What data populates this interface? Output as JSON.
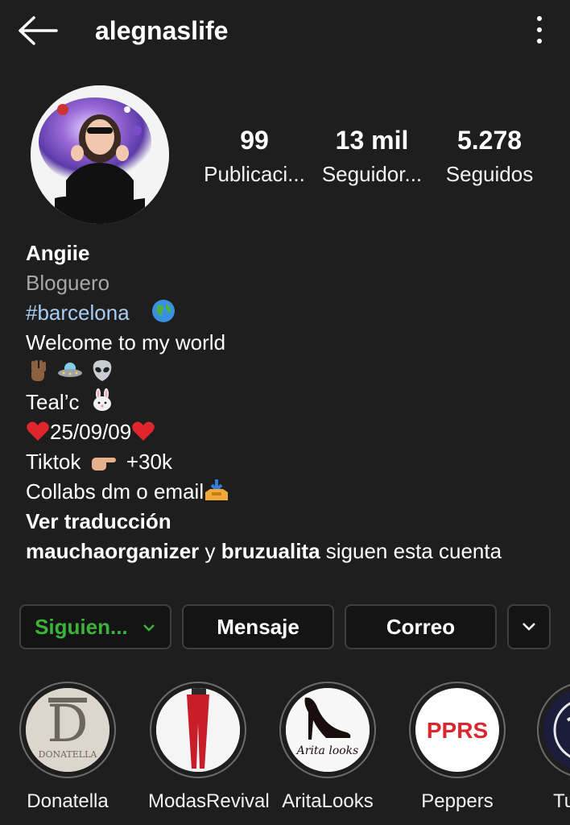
{
  "header": {
    "username": "alegnaslife"
  },
  "stats": [
    {
      "value": "99",
      "label": "Publicaci..."
    },
    {
      "value": "13 mil",
      "label": "Seguidor..."
    },
    {
      "value": "5.278",
      "label": "Seguidos"
    }
  ],
  "bio": {
    "name": "Angiie",
    "category": "Bloguero",
    "hashtag": "#barcelona",
    "line_welcome": "Welcome to my world",
    "line_tealc": "Teal’c",
    "line_date": "25/09/09",
    "line_tiktok_a": "Tiktok",
    "line_tiktok_b": "+30k",
    "line_collabs": "Collabs dm o email",
    "translate": "Ver traducción",
    "followed_by_1": "mauchaorganizer",
    "followed_by_sep": " y ",
    "followed_by_2": "bruzualita",
    "followed_by_suffix": " siguen esta cuenta"
  },
  "actions": {
    "following_label": "Siguien...",
    "message_label": "Mensaje",
    "email_label": "Correo"
  },
  "highlights": [
    {
      "label": "Donatella",
      "cover_text": "DONATELLA",
      "cover_letter": "D"
    },
    {
      "label": "ModasRevival"
    },
    {
      "label": "AritaLooks",
      "cover_text": "Arita looks"
    },
    {
      "label": "Peppers",
      "cover_text": "PPRS"
    },
    {
      "label": "Tu"
    }
  ],
  "colors": {
    "background": "#1e1e1e",
    "following_green": "#3cb33b",
    "hashtag_blue": "#a8cdf4",
    "peppers_red": "#d9262f"
  },
  "icons": [
    "back-arrow-icon",
    "more-vertical-icon",
    "chevron-down-icon"
  ]
}
